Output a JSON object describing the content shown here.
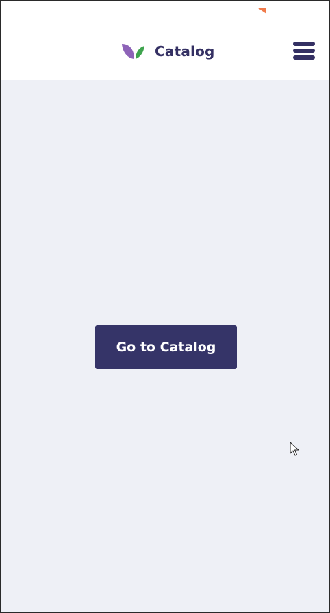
{
  "header": {
    "brand": {
      "name": "Catalog",
      "logo_icon": "leaf-logo-icon",
      "logo_colors": {
        "left_leaf": "#8e63b8",
        "right_leaf": "#3fa44e"
      }
    },
    "menu_icon": "hamburger-menu-icon",
    "accent_mark_color": "#f07a4a"
  },
  "main": {
    "cta_label": "Go to Catalog"
  },
  "colors": {
    "brand_navy": "#353468",
    "content_background": "#eef0f6",
    "header_background": "#ffffff"
  }
}
